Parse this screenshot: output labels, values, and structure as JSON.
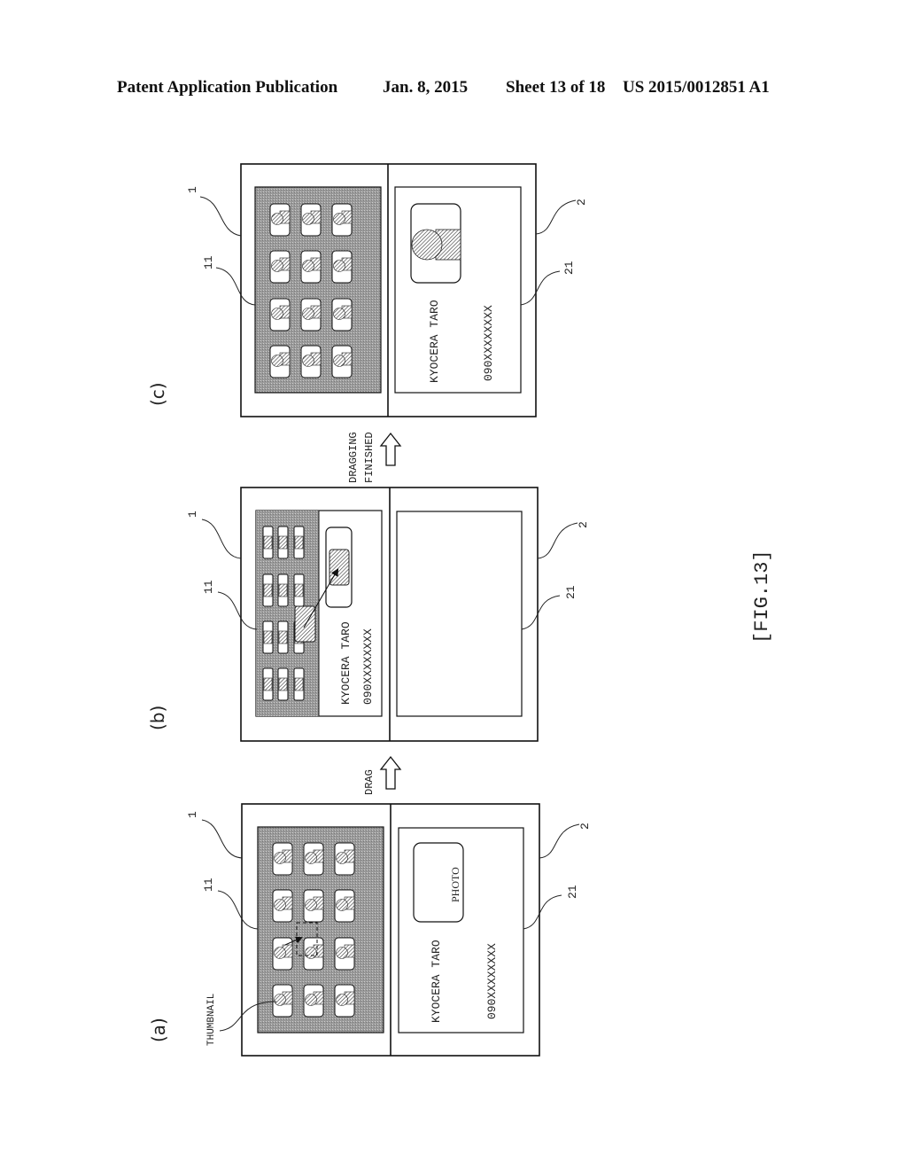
{
  "header": {
    "publication": "Patent Application Publication",
    "date": "Jan. 8, 2015",
    "sheet": "Sheet 13 of 18",
    "number": "US 2015/0012851 A1"
  },
  "figure_label": "[FIG.13]",
  "panels": [
    {
      "id": "a",
      "label": "(a)",
      "ref_device_1": "1",
      "ref_grid_11": "11",
      "ref_device_2": "2",
      "ref_card_21": "21",
      "thumbnail_label": "THUMBNAIL",
      "contact_name": "KYOCERA TARO",
      "contact_phone": "090XXXXXXXX",
      "photo_placeholder": "PHOTO"
    },
    {
      "id": "b",
      "label": "(b)",
      "ref_device_1": "1",
      "ref_grid_11": "11",
      "ref_device_2": "2",
      "ref_card_21": "21",
      "contact_name": "KYOCERA TARO",
      "contact_phone": "090XXXXXXXX"
    },
    {
      "id": "c",
      "label": "(c)",
      "ref_device_1": "1",
      "ref_grid_11": "11",
      "ref_device_2": "2",
      "ref_card_21": "21",
      "contact_name": "KYOCERA TARO",
      "contact_phone": "090XXXXXXXX"
    }
  ],
  "transitions": [
    {
      "label": "DRAG",
      "icon": "up-arrow-icon"
    },
    {
      "label_line1": "DRAGGING",
      "label_line2": "FINISHED",
      "icon": "up-arrow-icon"
    }
  ]
}
